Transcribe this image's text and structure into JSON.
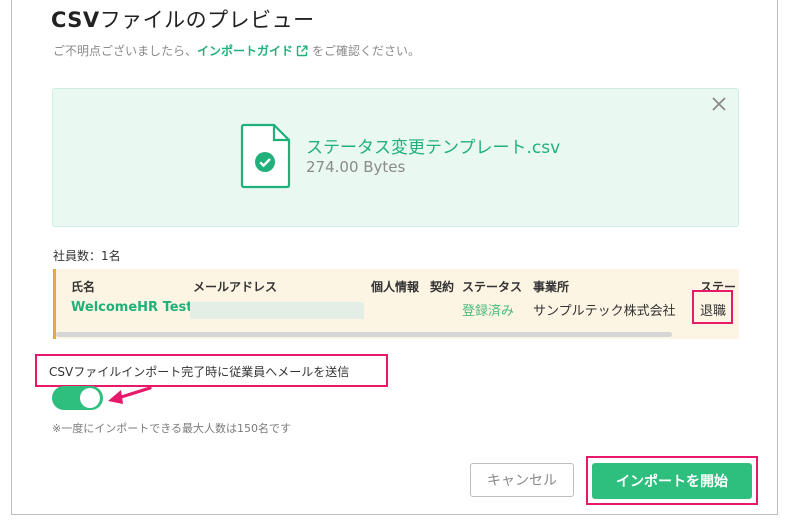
{
  "dialog": {
    "title_prefix": "CSV",
    "title_rest": "ファイルのプレビュー",
    "hint_before": "ご不明点ございましたら、",
    "hint_link": "インポートガイド",
    "hint_after": "をご確認ください。"
  },
  "file": {
    "name": "ステータス変更テンプレート.csv",
    "size": "274.00 Bytes"
  },
  "employees": {
    "count_label": "社員数：1名"
  },
  "table": {
    "headers": [
      "氏名",
      "メールアドレス",
      "個人情報",
      "契約",
      "ステータス",
      "事業所",
      "ステー"
    ],
    "row": {
      "name": "WelcomeHR Test",
      "status": "登録済み",
      "office": "サンプルテック株式会社",
      "new_status": "退職"
    }
  },
  "send_mail": {
    "label": "CSVファイルインポート完了時に従業員へメールを送信",
    "enabled": true
  },
  "note": "※一度にインポートできる最大人数は150名です",
  "buttons": {
    "cancel": "キャンセル",
    "start": "インポートを開始"
  },
  "colors": {
    "accent_green": "#2ebe7e",
    "highlight_red": "#e8196b",
    "warning_border": "#e8a73a"
  },
  "icons": [
    "external-link-icon",
    "close-icon",
    "csv-file-check-icon",
    "arrow-pointer-icon"
  ]
}
